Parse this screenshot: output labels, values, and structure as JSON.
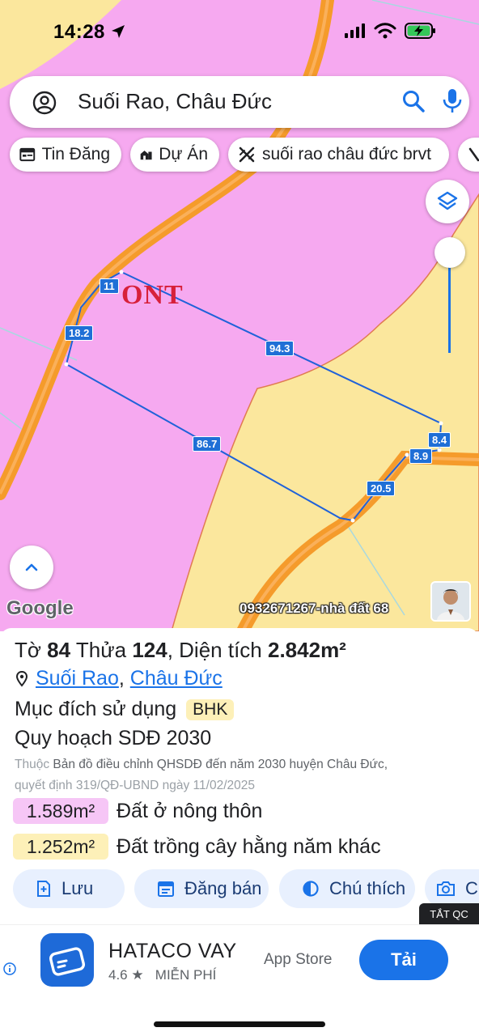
{
  "status": {
    "time": "14:28"
  },
  "search": {
    "query": "Suối Rao, Châu Đức"
  },
  "chips": [
    {
      "label": "Tin Đăng",
      "icon": "listing-icon"
    },
    {
      "label": "Dự Án",
      "icon": "building-icon"
    },
    {
      "label": "suối rao châu đức brvt",
      "icon": "hatch-icon"
    }
  ],
  "map": {
    "zone_label": "ONT",
    "dimensions": [
      "11",
      "18.2",
      "94.3",
      "86.7",
      "8.4",
      "8.9",
      "20.5"
    ],
    "google": "Google",
    "watermark": "0932671267-nhà đất 68",
    "colors": {
      "residential": "#f6a9f0",
      "perennial": "#fbe79d",
      "road": "#f59b2b",
      "boundary": "#1f62d9"
    }
  },
  "panel": {
    "title_to_label": "Tờ",
    "title_to_value": "84",
    "title_thua_label": "Thửa",
    "title_thua_value": "124",
    "title_area_label": "Diện tích",
    "title_area_value": "2.842m²",
    "loc_ward": "Suối Rao",
    "loc_district": "Châu Đức",
    "purpose_label": "Mục đích sử dụng",
    "purpose_code": "BHK",
    "plan_title": "Quy hoạch SDĐ 2030",
    "source_prefix": "Thuộc",
    "source_link": "Bản đồ điều chỉnh QHSDĐ đến năm 2030 huyện Châu Đức,",
    "source_decision": "quyết định 319/QĐ-UBND ngày 11/02/2025",
    "lands": [
      {
        "area": "1.589m²",
        "name": "Đất ở nông thôn",
        "color": "#f6c6f6"
      },
      {
        "area": "1.252m²",
        "name": "Đất trồng cây hằng năm khác",
        "color": "#fdf0b8"
      }
    ],
    "actions": [
      {
        "label": "Lưu",
        "icon": "bookmark-add-icon"
      },
      {
        "label": "Đăng bán",
        "icon": "calendar-icon"
      },
      {
        "label": "Chú thích",
        "icon": "contrast-icon"
      },
      {
        "label": "C",
        "icon": "camera-icon"
      }
    ]
  },
  "ad": {
    "tag": "TẮT QC",
    "app_name": "HATACO VAY",
    "rating": "4.6 ★",
    "price": "MIỄN PHÍ",
    "store": "App Store",
    "install": "Tải"
  }
}
